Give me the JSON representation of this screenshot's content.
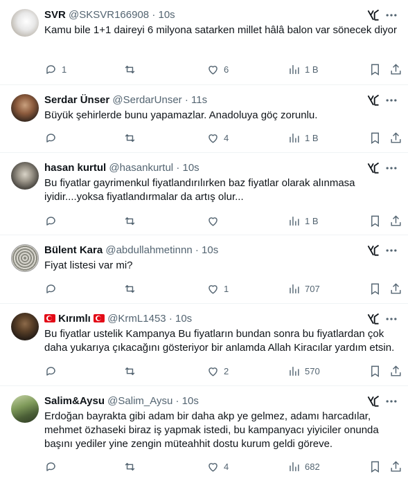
{
  "tweets": [
    {
      "name": "SVR",
      "handle": "@SKSVR166908",
      "time": "10s",
      "text": "Kamu bile 1+1 daireyi 6 milyona satarken millet hâlâ balon var sönecek diyor",
      "replies": "1",
      "retweets": "",
      "likes": "6",
      "views": "1 B",
      "avatar": "white-cat-avatar"
    },
    {
      "name": "Serdar Ünser",
      "handle": "@SerdarUnser",
      "time": "11s",
      "text": "Büyük şehirlerde bunu yapamazlar. Anadoluya göç zorunlu.",
      "replies": "",
      "retweets": "",
      "likes": "4",
      "views": "1 B",
      "avatar": "man-avatar"
    },
    {
      "name": "hasan kurtul",
      "handle": "@hasankurtul",
      "time": "10s",
      "text": "Bu fiyatlar gayrimenkul fiyatlandırılırken baz fiyatlar olarak alınmasa iyidir....yoksa fiyatlandırmalar da artış olur...",
      "replies": "",
      "retweets": "",
      "likes": "",
      "views": "1 B",
      "avatar": "portrait-avatar"
    },
    {
      "name": "Bülent Kara",
      "handle": "@abdullahmetinnn",
      "time": "10s",
      "text": "Fiyat listesi var mi?",
      "replies": "",
      "retweets": "",
      "likes": "1",
      "views": "707",
      "avatar": "ornament-avatar"
    },
    {
      "name": "Kırımlı",
      "handle": "@KrmL1453",
      "time": "10s",
      "text": "Bu fiyatlar ustelik Kampanya Bu fiyatların bundan sonra bu fiyatlardan çok daha yukarıya çıkacağını gösteriyor bir anlamda Allah Kiracılar yardım etsin.",
      "replies": "",
      "retweets": "",
      "likes": "2",
      "views": "570",
      "avatar": "dark-portrait-avatar",
      "flags": true
    },
    {
      "name": "Salim&Aysu",
      "handle": "@Salim_Aysu",
      "time": "10s",
      "text": "Erdoğan bayrakta gibi adam bir daha akp ye gelmez, adamı harcadılar, mehmet özhaseki biraz iş yapmak istedi, bu kampanyacı yiyiciler onunda başını yediler yine zengin müteahhit dostu kurum geldi göreve.",
      "replies": "",
      "retweets": "",
      "likes": "4",
      "views": "682",
      "avatar": "landscape-avatar"
    }
  ],
  "dot": "·",
  "colors": {
    "secondary": "#536471",
    "text": "#0f1419",
    "border": "#eff3f4"
  }
}
